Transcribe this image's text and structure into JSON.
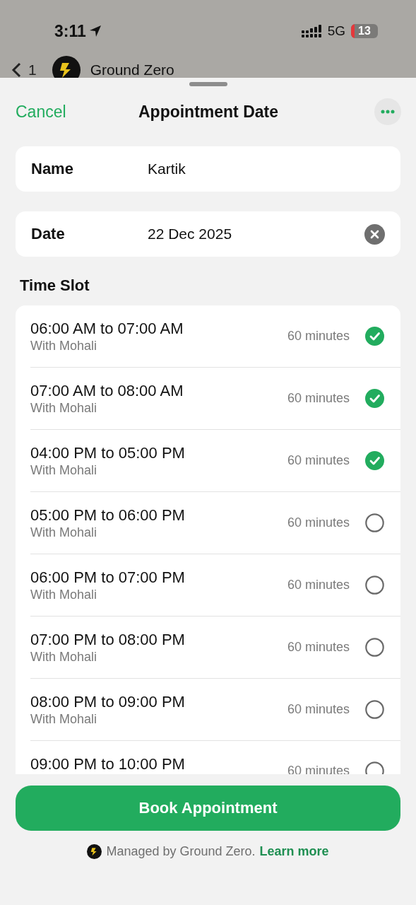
{
  "status_bar": {
    "time": "3:11",
    "network": "5G",
    "battery": "13"
  },
  "background_nav": {
    "back_count": "1",
    "title": "Ground Zero"
  },
  "header": {
    "cancel": "Cancel",
    "title": "Appointment Date"
  },
  "fields": [
    {
      "label": "Name",
      "value": "Kartik",
      "clearable": false
    },
    {
      "label": "Date",
      "value": "22 Dec 2025",
      "clearable": true
    }
  ],
  "section_title": "Time Slot",
  "slots": [
    {
      "time": "06:00 AM to 07:00 AM",
      "subtitle": "With Mohali",
      "duration": "60 minutes",
      "selected": true
    },
    {
      "time": "07:00 AM to 08:00 AM",
      "subtitle": "With Mohali",
      "duration": "60 minutes",
      "selected": true
    },
    {
      "time": "04:00 PM to 05:00 PM",
      "subtitle": "With Mohali",
      "duration": "60 minutes",
      "selected": true
    },
    {
      "time": "05:00 PM to 06:00 PM",
      "subtitle": "With Mohali",
      "duration": "60 minutes",
      "selected": false
    },
    {
      "time": "06:00 PM to 07:00 PM",
      "subtitle": "With Mohali",
      "duration": "60 minutes",
      "selected": false
    },
    {
      "time": "07:00 PM to 08:00 PM",
      "subtitle": "With Mohali",
      "duration": "60 minutes",
      "selected": false
    },
    {
      "time": "08:00 PM to 09:00 PM",
      "subtitle": "With Mohali",
      "duration": "60 minutes",
      "selected": false
    },
    {
      "time": "09:00 PM to 10:00 PM",
      "duration": "60 minutes",
      "selected": false
    }
  ],
  "book_button": "Book Appointment",
  "footer": {
    "text": "Managed by Ground Zero.",
    "link": "Learn more"
  }
}
